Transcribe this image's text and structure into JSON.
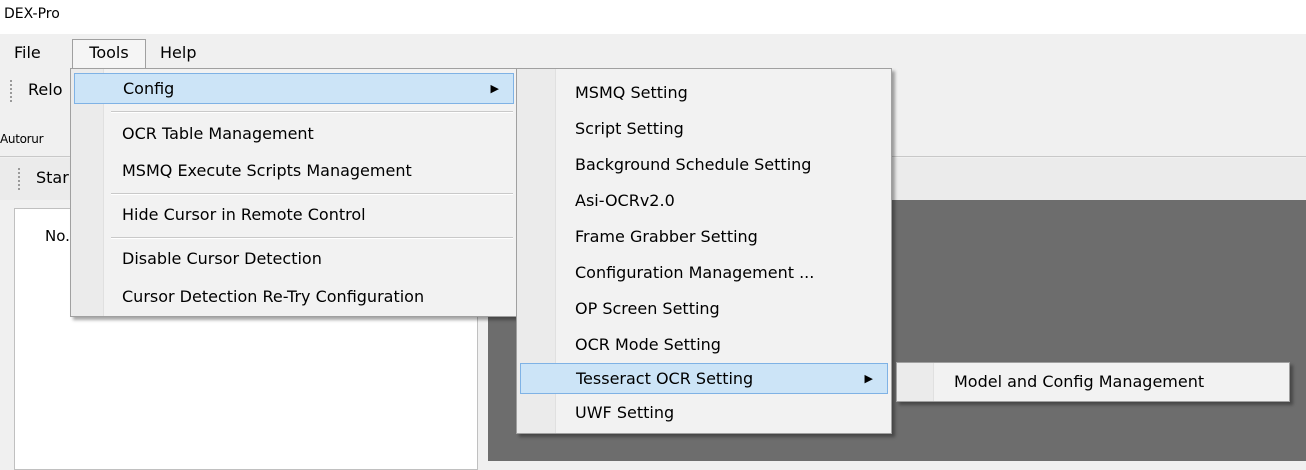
{
  "app_title": "DEX-Pro",
  "menubar": {
    "file": "File",
    "tools": "Tools",
    "help": "Help"
  },
  "toolbar": {
    "reload_label": "Relo"
  },
  "tabs": {
    "autorun": "Autorur"
  },
  "toolstrip": {
    "start_label": "Star"
  },
  "left_panel": {
    "col_no": "No."
  },
  "tools_menu": {
    "config": "Config",
    "ocr_table": "OCR Table Management",
    "msmq_scripts": "MSMQ Execute Scripts Management",
    "hide_cursor": "Hide Cursor in Remote Control",
    "disable_cursor": "Disable Cursor Detection",
    "cursor_retry": "Cursor Detection Re-Try Configuration"
  },
  "config_menu": {
    "msmq": "MSMQ Setting",
    "script": "Script Setting",
    "background": "Background Schedule Setting",
    "asi_ocr": "Asi-OCRv2.0",
    "frame_grabber": "Frame Grabber Setting",
    "config_mgmt": "Configuration Management ...",
    "op_screen": "OP Screen Setting",
    "ocr_mode": "OCR Mode Setting",
    "tesseract": "Tesseract OCR Setting",
    "uwf": "UWF Setting"
  },
  "tesseract_menu": {
    "model_config": "Model and Config Management"
  },
  "icons": {
    "submenu_arrow": "right-triangle",
    "grip": "toolbar-grip"
  },
  "colors": {
    "highlight_bg": "#cce4f7",
    "highlight_border": "#7fb2e5",
    "viewer_bg": "#6d6d6d"
  }
}
